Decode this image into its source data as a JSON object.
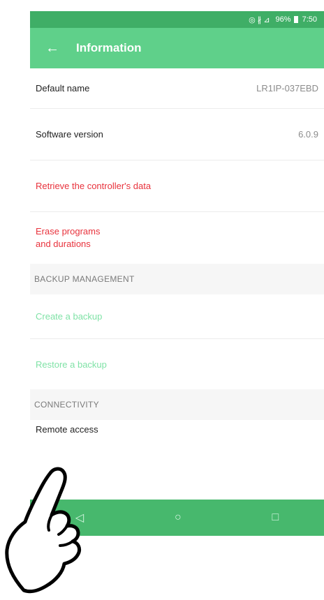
{
  "status_bar": {
    "icons": "◎ ∦ ⊿",
    "battery": "96%",
    "time": "7:50"
  },
  "app_bar": {
    "back_icon": "arrow-left-icon",
    "title": "Information"
  },
  "rows": {
    "default_name": {
      "label": "Default name",
      "value": "LR1IP-037EBD"
    },
    "software_version": {
      "label": "Software version",
      "value": "6.0.9"
    },
    "retrieve_data": {
      "label": "Retrieve the controller's data"
    },
    "erase_programs": {
      "line1": "Erase programs",
      "line2": "and durations"
    }
  },
  "backup_section": {
    "header": "BACKUP MANAGEMENT",
    "create": "Create a backup",
    "restore": "Restore a backup"
  },
  "connectivity_section": {
    "header": "CONNECTIVITY",
    "remote_access": "Remote access"
  },
  "nav_bar": {
    "back": "◁",
    "home": "○",
    "recents": "□"
  },
  "colors": {
    "status_bar": "#3fae66",
    "app_bar": "#5fd08a",
    "destructive_text": "#e8323c",
    "action_text": "#7fe2a6",
    "nav_bar": "#47b86d"
  }
}
